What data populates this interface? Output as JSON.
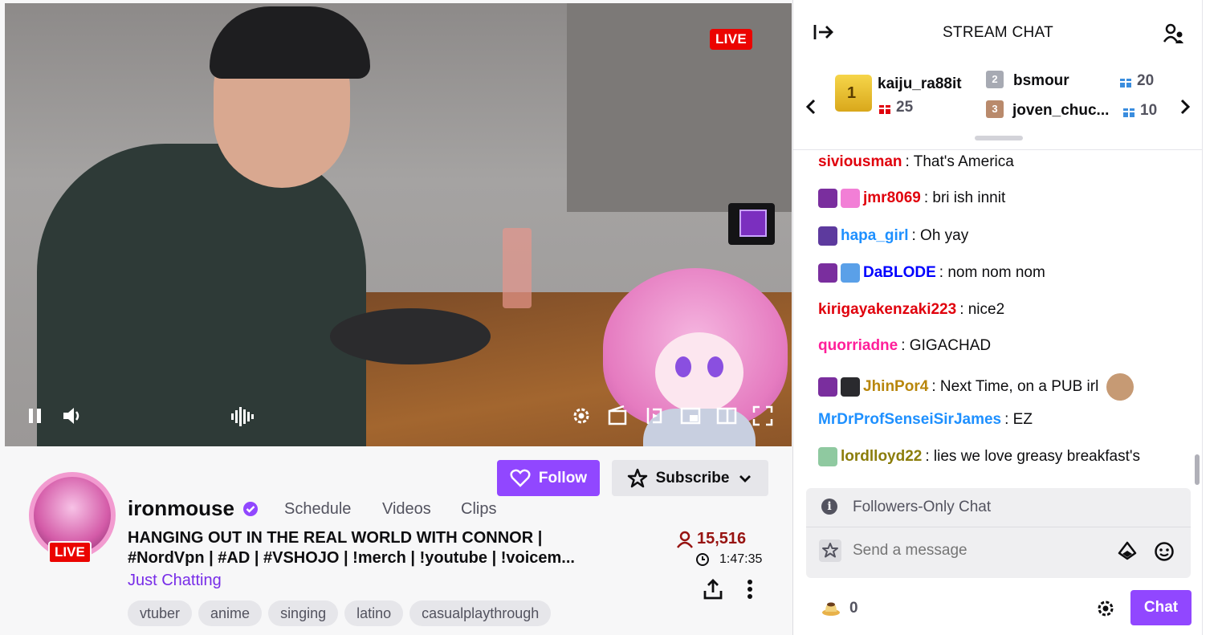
{
  "video": {
    "live_label": "LIVE"
  },
  "channel": {
    "name": "ironmouse",
    "live_label": "LIVE",
    "links": [
      "Schedule",
      "Videos",
      "Clips"
    ],
    "title_line1": "HANGING OUT IN THE REAL WORLD WITH CONNOR |",
    "title_line2": "#NordVpn | #AD | #VSHOJO | !merch | !youtube | !voicem...",
    "category": "Just Chatting",
    "viewers": "15,516",
    "uptime": "1:47:35",
    "follow_label": "Follow",
    "subscribe_label": "Subscribe",
    "tags": [
      "vtuber",
      "anime",
      "singing",
      "latino",
      "casualplaythrough"
    ]
  },
  "chat": {
    "title": "STREAM CHAT",
    "leaderboard": {
      "first": {
        "name": "kaiju_ra88it",
        "count": "25",
        "rank": "1"
      },
      "second": {
        "name": "bsmour",
        "count": "20",
        "rank": "2"
      },
      "third": {
        "name": "joven_chuc...",
        "count": "10",
        "rank": "3"
      }
    },
    "messages": [
      {
        "user": "siviousman",
        "text": ": That's America",
        "color": "#e0000c"
      },
      {
        "user": "jmr8069",
        "text": ": bri ish innit",
        "color": "#e0000c"
      },
      {
        "user": "hapa_girl",
        "text": ": Oh yay",
        "color": "#1e90ff"
      },
      {
        "user": "DaBLODE",
        "text": ": nom nom nom",
        "color": "#0000ff"
      },
      {
        "user": "kirigayakenzaki223",
        "text": ": nice2",
        "color": "#e0000c"
      },
      {
        "user": "quorriadne",
        "text": ": GIGACHAD",
        "color": "#ff1f9a"
      },
      {
        "user": "JhinPor4",
        "text": ": Next Time, on a PUB irl",
        "color": "#b8860b"
      },
      {
        "user": "MrDrProfSenseiSirJames",
        "text": ": EZ",
        "color": "#1e90ff"
      },
      {
        "user": "lordlloyd22",
        "text": ": lies we love greasy breakfast's",
        "color": "#8b7d0b"
      }
    ],
    "followers_only": "Followers-Only Chat",
    "placeholder": "Send a message",
    "points": "0",
    "chat_button": "Chat"
  },
  "icons": [
    "collapse-chat-icon",
    "community-icon",
    "pause-icon",
    "volume-icon",
    "audio-only-icon",
    "settings-icon",
    "clip-icon",
    "rewind-icon",
    "theatre-icon",
    "sidebar-icon",
    "fullscreen-icon",
    "heart-icon",
    "star-icon",
    "chevron-down-icon",
    "person-icon",
    "clock-icon",
    "share-icon",
    "more-icon",
    "gift-icon",
    "info-icon",
    "bits-icon",
    "emote-icon",
    "channel-points-icon",
    "gear-icon"
  ],
  "colors": {
    "accent": "#9147ff",
    "live_red": "#eb0400",
    "viewer_count": "#971311",
    "category": "#772ce8"
  }
}
